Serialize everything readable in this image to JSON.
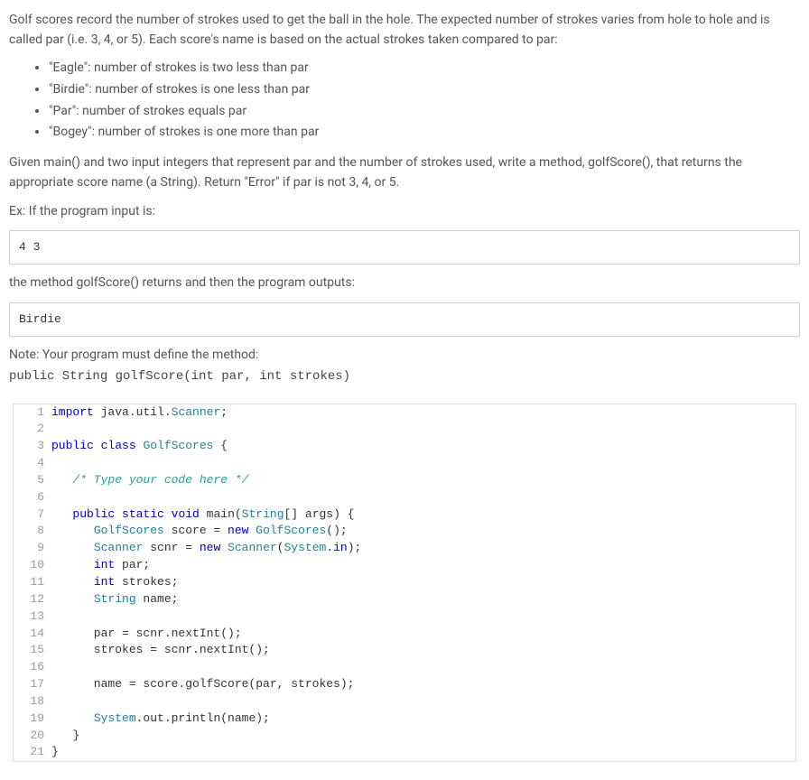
{
  "intro": {
    "p1": "Golf scores record the number of strokes used to get the ball in the hole. The expected number of strokes varies from hole to hole and is called par (i.e. 3, 4, or 5). Each score's name is based on the actual strokes taken compared to par:",
    "bullets": [
      "\"Eagle\": number of strokes is two less than par",
      "\"Birdie\": number of strokes is one less than par",
      "\"Par\": number of strokes equals par",
      "\"Bogey\": number of strokes is one more than par"
    ],
    "p2": "Given main() and two input integers that represent par and the number of strokes used, write a method, golfScore(), that returns the appropriate score name (a String). Return \"Error\" if par is not 3, 4, or 5.",
    "ex_label": "Ex: If the program input is:",
    "ex_input": "4 3",
    "ex_mid": "the method golfScore() returns and then the program outputs:",
    "ex_output": "Birdie",
    "note_text": "Note: Your program must define the method:",
    "note_sig": "public String golfScore(int par, int strokes)"
  },
  "code": {
    "lines": [
      {
        "n": "1",
        "tokens": [
          [
            "kw",
            "import"
          ],
          [
            "id",
            " java.util."
          ],
          [
            "type",
            "Scanner"
          ],
          [
            "id",
            ";"
          ]
        ]
      },
      {
        "n": "2",
        "tokens": []
      },
      {
        "n": "3",
        "tokens": [
          [
            "kw",
            "public"
          ],
          [
            "id",
            " "
          ],
          [
            "kw",
            "class"
          ],
          [
            "id",
            " "
          ],
          [
            "type",
            "GolfScores"
          ],
          [
            "id",
            " {"
          ]
        ]
      },
      {
        "n": "4",
        "tokens": []
      },
      {
        "n": "5",
        "tokens": [
          [
            "id",
            "   "
          ],
          [
            "com",
            "/* Type your code here */"
          ]
        ]
      },
      {
        "n": "6",
        "tokens": []
      },
      {
        "n": "7",
        "tokens": [
          [
            "id",
            "   "
          ],
          [
            "kw",
            "public"
          ],
          [
            "id",
            " "
          ],
          [
            "kw",
            "static"
          ],
          [
            "id",
            " "
          ],
          [
            "kw",
            "void"
          ],
          [
            "id",
            " main("
          ],
          [
            "type",
            "String"
          ],
          [
            "id",
            "[] args) {"
          ]
        ]
      },
      {
        "n": "8",
        "tokens": [
          [
            "id",
            "      "
          ],
          [
            "type",
            "GolfScores"
          ],
          [
            "id",
            " score = "
          ],
          [
            "kw",
            "new"
          ],
          [
            "id",
            " "
          ],
          [
            "type",
            "GolfScores"
          ],
          [
            "id",
            "();"
          ]
        ]
      },
      {
        "n": "9",
        "tokens": [
          [
            "id",
            "      "
          ],
          [
            "type",
            "Scanner"
          ],
          [
            "id",
            " scnr = "
          ],
          [
            "kw",
            "new"
          ],
          [
            "id",
            " "
          ],
          [
            "type",
            "Scanner"
          ],
          [
            "id",
            "("
          ],
          [
            "type",
            "System"
          ],
          [
            "id",
            "."
          ],
          [
            "kw",
            "in"
          ],
          [
            "id",
            ");"
          ]
        ]
      },
      {
        "n": "10",
        "tokens": [
          [
            "id",
            "      "
          ],
          [
            "kw",
            "int"
          ],
          [
            "id",
            " par;"
          ]
        ]
      },
      {
        "n": "11",
        "tokens": [
          [
            "id",
            "      "
          ],
          [
            "kw",
            "int"
          ],
          [
            "id",
            " strokes;"
          ]
        ]
      },
      {
        "n": "12",
        "tokens": [
          [
            "id",
            "      "
          ],
          [
            "type",
            "String"
          ],
          [
            "id",
            " name;"
          ]
        ]
      },
      {
        "n": "13",
        "tokens": []
      },
      {
        "n": "14",
        "tokens": [
          [
            "id",
            "      par = scnr.nextInt();"
          ]
        ]
      },
      {
        "n": "15",
        "tokens": [
          [
            "id",
            "      strokes = scnr.nextInt();"
          ]
        ]
      },
      {
        "n": "16",
        "tokens": []
      },
      {
        "n": "17",
        "tokens": [
          [
            "id",
            "      name = score.golfScore(par, strokes);"
          ]
        ]
      },
      {
        "n": "18",
        "tokens": []
      },
      {
        "n": "19",
        "tokens": [
          [
            "id",
            "      "
          ],
          [
            "type",
            "System"
          ],
          [
            "id",
            ".out.println(name);"
          ]
        ]
      },
      {
        "n": "20",
        "tokens": [
          [
            "id",
            "   }"
          ]
        ]
      },
      {
        "n": "21",
        "tokens": [
          [
            "id",
            "}"
          ]
        ]
      }
    ]
  }
}
